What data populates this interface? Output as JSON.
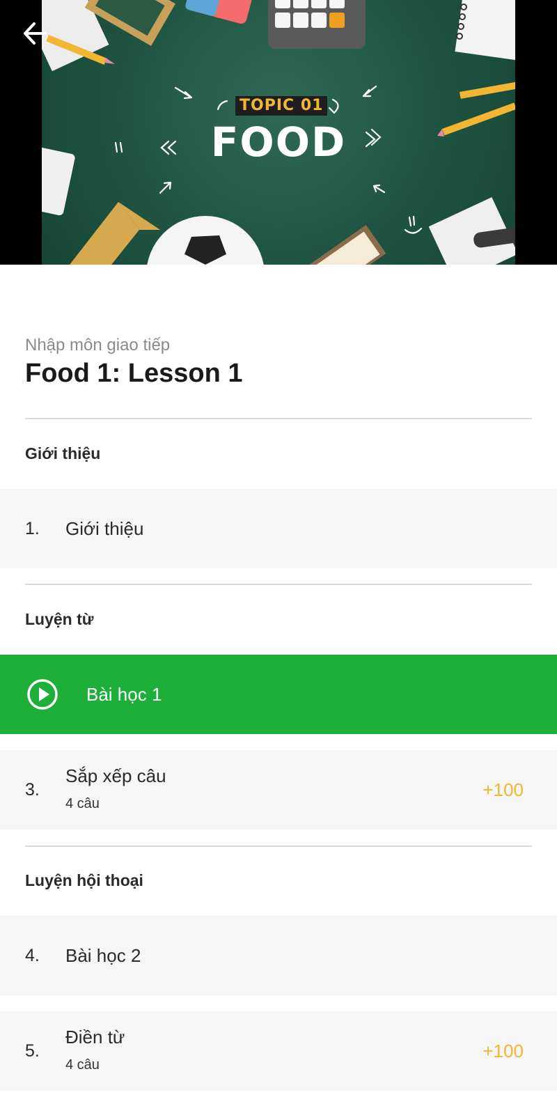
{
  "hero": {
    "topic_tag": "TOPIC 01",
    "topic_title": "FOOD"
  },
  "header": {
    "subtitle": "Nhập môn giao tiếp",
    "title": "Food 1: Lesson 1"
  },
  "sections": [
    {
      "title": "Giới thiệu",
      "items": [
        {
          "number": "1.",
          "label": "Giới thiệu"
        }
      ]
    },
    {
      "title": "Luyện từ",
      "items": [
        {
          "label": "Bài học 1",
          "active": true,
          "icon": "play-circle-icon"
        },
        {
          "number": "3.",
          "label": "Sắp xếp câu",
          "sub": "4 câu",
          "points": "+100"
        }
      ]
    },
    {
      "title": "Luyện hội thoại",
      "items": [
        {
          "number": "4.",
          "label": "Bài học 2"
        },
        {
          "number": "5.",
          "label": "Điền từ",
          "sub": "4 câu",
          "points": "+100"
        }
      ]
    }
  ],
  "colors": {
    "active_green": "#1eaf3a",
    "points_yellow": "#f2b632",
    "row_bg": "#f6f6f6",
    "board_green": "#1f5443"
  },
  "icons": {
    "back": "arrow-left-icon",
    "play": "play-circle-icon"
  }
}
